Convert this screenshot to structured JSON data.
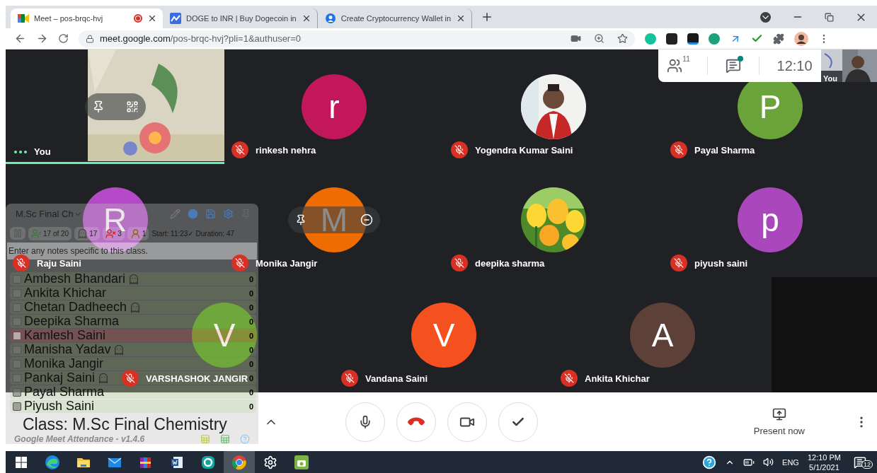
{
  "browser": {
    "tabs": [
      {
        "title": "Meet – pos-brqc-hvj",
        "selected": true,
        "recording": true
      },
      {
        "title": "DOGE to INR | Buy Dogecoin in",
        "selected": false,
        "recording": false
      },
      {
        "title": "Create Cryptocurrency Wallet in",
        "selected": false,
        "recording": false
      }
    ],
    "address": {
      "domain": "meet.google.com",
      "path": "/pos-brqc-hvj?pli=1&authuser=0"
    }
  },
  "meeting": {
    "people_count": "11",
    "chat_unread": true,
    "time": "12:10",
    "self_label": "You",
    "rows": [
      [
        {
          "kind": "video",
          "name": "You",
          "hovered": true,
          "speaking": true
        },
        {
          "kind": "letter",
          "letter": "r",
          "color": "#c2185b",
          "name": "rinkesh nehra",
          "muted": true,
          "hovered": false,
          "speaking": false
        },
        {
          "name": "Yogendra Kumar Saini",
          "muted": true,
          "hovered": false,
          "speaking": false
        },
        {
          "kind": "letter",
          "letter": "P",
          "color": "#6aa33a",
          "name": "Payal Sharma",
          "muted": true,
          "hovered": false,
          "speaking": false
        }
      ],
      [
        {
          "kind": "letter",
          "letter": "R",
          "color": "#b44ac8",
          "name": "Raju Saini",
          "muted": true,
          "hovered": false,
          "speaking": false
        },
        {
          "kind": "letter",
          "letter": "M",
          "color": "#ef6c00",
          "name": "Monika Jangir",
          "muted": true,
          "hovered": true,
          "speaking": false
        },
        {
          "kind": "flowers",
          "name": "deepika sharma",
          "muted": true,
          "hovered": false,
          "speaking": false
        },
        {
          "kind": "letter",
          "letter": "p",
          "color": "#ab47bc",
          "name": "piyush saini",
          "muted": true,
          "hovered": false,
          "speaking": false
        }
      ],
      [
        {
          "kind": "letter",
          "letter": "V",
          "color": "#6aa33a",
          "name": "VARSHASHOK JANGIR",
          "muted": true,
          "hovered": false,
          "speaking": false
        },
        {
          "kind": "letter",
          "letter": "V",
          "color": "#f4511e",
          "name": "Vandana Saini",
          "muted": true,
          "hovered": false,
          "speaking": false
        },
        {
          "kind": "letter",
          "letter": "A",
          "color": "#5d4037",
          "name": "Ankita Khichar",
          "muted": true,
          "hovered": false,
          "speaking": false
        }
      ]
    ]
  },
  "attendance": {
    "class_select": "M.Sc Final Ch",
    "stats": [
      {
        "kind": "present",
        "value": "17 of 20"
      },
      {
        "kind": "ghost",
        "value": "17"
      },
      {
        "kind": "absent",
        "value": "3"
      },
      {
        "kind": "unknown",
        "value": "1"
      }
    ],
    "timing": "Start: 11:23✓ Duration: 47",
    "notes_placeholder": "Enter any notes specific to this class.",
    "students": [
      {
        "name": "Ambesh Bhandari",
        "checked": true,
        "ghost": true,
        "count": "0"
      },
      {
        "name": "Ankita Khichar",
        "checked": true,
        "ghost": false,
        "count": "0"
      },
      {
        "name": "Chetan Dadheech",
        "checked": true,
        "ghost": true,
        "count": "0"
      },
      {
        "name": "Deepika Sharma",
        "checked": true,
        "ghost": false,
        "count": "0"
      },
      {
        "name": "Kamlesh Saini",
        "checked": false,
        "ghost": false,
        "count": "0"
      },
      {
        "name": "Manisha Yadav",
        "checked": true,
        "ghost": true,
        "count": "0"
      },
      {
        "name": "Monika Jangir",
        "checked": true,
        "ghost": false,
        "count": "0"
      },
      {
        "name": "Pankaj Saini",
        "checked": true,
        "ghost": true,
        "count": "0"
      },
      {
        "name": "Payal Sharma",
        "checked": true,
        "ghost": false,
        "count": "0"
      },
      {
        "name": "Piyush Saini",
        "checked": true,
        "ghost": false,
        "count": "0"
      }
    ],
    "class_label": "Class: M.Sc Final Chemistry",
    "footer": "Google Meet Attendance - v1.4.6"
  },
  "controls": {
    "mic_muted": false,
    "camera_on": true,
    "present_label": "Present now"
  },
  "taskbar": {
    "apps": [
      {
        "kind": "edge",
        "selected": false
      },
      {
        "kind": "folder",
        "selected": false
      },
      {
        "kind": "mail",
        "selected": false
      },
      {
        "kind": "archive",
        "selected": false
      },
      {
        "kind": "word",
        "selected": false
      },
      {
        "kind": "antivirus",
        "selected": false
      },
      {
        "kind": "chrome",
        "selected": true
      },
      {
        "kind": "settings",
        "selected": false
      },
      {
        "kind": "android",
        "selected": false
      }
    ],
    "language": "ENG",
    "time": "12:10 PM",
    "date": "5/1/2021",
    "notifications": "12"
  }
}
